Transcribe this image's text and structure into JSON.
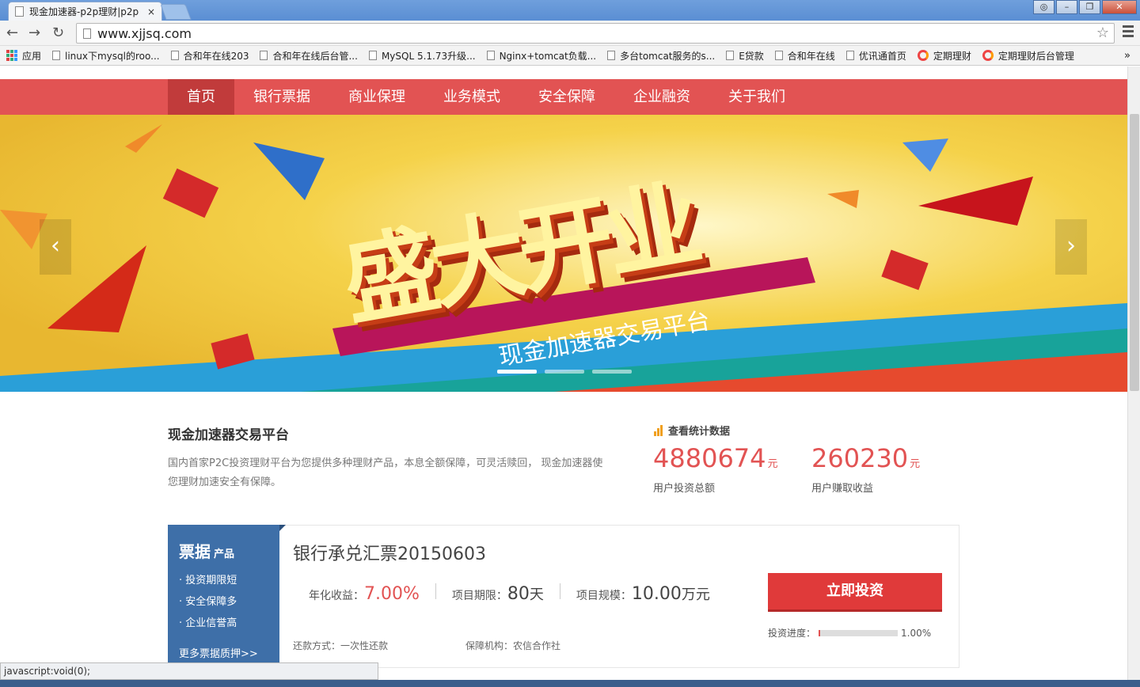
{
  "browser": {
    "tab_title": "现金加速器-p2p理财|p2p",
    "tab_close": "×",
    "url": "www.xjjsq.com",
    "bookmarks": [
      {
        "label": "应用",
        "icon": "apps-icon"
      },
      {
        "label": "linux下mysql的roo...",
        "icon": "page-icon"
      },
      {
        "label": "合和年在线203",
        "icon": "page-icon"
      },
      {
        "label": "合和年在线后台管...",
        "icon": "page-icon"
      },
      {
        "label": "MySQL 5.1.73升级...",
        "icon": "page-icon"
      },
      {
        "label": "Nginx+tomcat负载...",
        "icon": "page-icon"
      },
      {
        "label": "多台tomcat服务的s...",
        "icon": "page-icon"
      },
      {
        "label": "E贷款",
        "icon": "page-icon"
      },
      {
        "label": "合和年在线",
        "icon": "page-icon"
      },
      {
        "label": "优讯通首页",
        "icon": "page-icon"
      },
      {
        "label": "定期理财",
        "icon": "site-logo-icon"
      },
      {
        "label": "定期理财后台管理",
        "icon": "site-logo-icon"
      }
    ],
    "bookmarks_more": "»",
    "status_text": "javascript:void(0);"
  },
  "nav": {
    "items": [
      "首页",
      "银行票据",
      "商业保理",
      "业务模式",
      "安全保障",
      "企业融资",
      "关于我们"
    ],
    "active_index": 0,
    "color": "#e25353",
    "active_color": "#c13b3b"
  },
  "banner": {
    "headline": "盛大开业",
    "subline": "现金加速器交易平台",
    "prev": "‹",
    "next": "›",
    "slides": 3,
    "active_slide": 0
  },
  "intro": {
    "title": "现金加速器交易平台",
    "description": "国内首家P2C投资理财平台为您提供多种理财产品，本息全额保障，可灵活赎回， 现金加速器使您理财加速安全有保障。"
  },
  "stats": {
    "title": "查看统计数据",
    "items": [
      {
        "value": "4880674",
        "unit": "元",
        "label": "用户投资总额"
      },
      {
        "value": "260230",
        "unit": "元",
        "label": "用户赚取收益"
      }
    ]
  },
  "product_side": {
    "title": "票据",
    "title_small": "产品",
    "features": [
      "投资期限短",
      "安全保障多",
      "企业信誉高"
    ],
    "more": "更多票据质押>>"
  },
  "product": {
    "name": "银行承兑汇票20150603",
    "rate_label": "年化收益：",
    "rate": "7.00%",
    "term_label": "项目期限：",
    "term": "80",
    "term_unit": "天",
    "scale_label": "项目规模：",
    "scale": "10.00",
    "scale_unit": "万元",
    "repay": "还款方式：一次性还款",
    "guarantor": "保障机构：农信合作社",
    "button": "立即投资",
    "progress_label": "投资进度：",
    "progress_text": "1.00%",
    "progress_fraction": 0.01
  }
}
